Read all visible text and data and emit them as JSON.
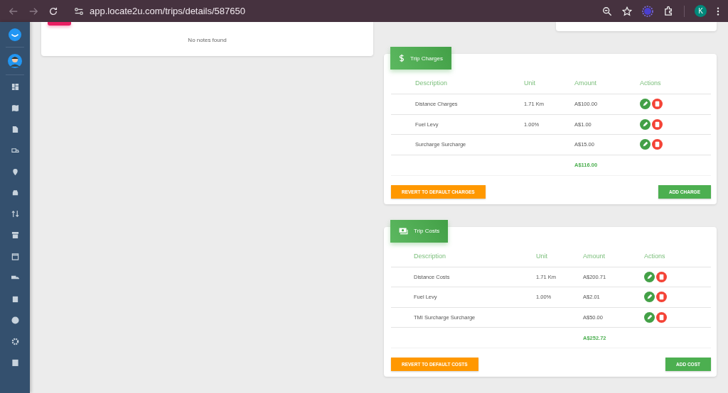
{
  "browser": {
    "url": "app.locate2u.com/trips/details/587650",
    "profile": "K"
  },
  "notes": {
    "empty_text": "No notes found"
  },
  "sections": [
    {
      "title": "Trip Charges",
      "kind": "charges",
      "columns": [
        "Description",
        "Unit",
        "Amount",
        "Actions"
      ],
      "rows": [
        {
          "description": "Distance Charges",
          "unit": "1.71 Km",
          "amount": "A$100.00"
        },
        {
          "description": "Fuel Levy",
          "unit": "1.00%",
          "amount": "A$1.00"
        },
        {
          "description": "Surcharge Surcharge",
          "unit": "",
          "amount": "A$15.00"
        }
      ],
      "total": "A$116.00",
      "revert_button": "REVERT TO DEFAULT CHARGES",
      "add_button": "ADD CHARGE"
    },
    {
      "title": "Trip Costs",
      "kind": "costs",
      "columns": [
        "Description",
        "Unit",
        "Amount",
        "Actions"
      ],
      "rows": [
        {
          "description": "Distance Costs",
          "unit": "1.71 Km",
          "amount": "A$200.71"
        },
        {
          "description": "Fuel Levy",
          "unit": "1.00%",
          "amount": "A$2.01"
        },
        {
          "description": "TMI Surcharge Surcharge",
          "unit": "",
          "amount": "A$50.00"
        }
      ],
      "total": "A$252.72",
      "revert_button": "REVERT TO DEFAULT COSTS",
      "add_button": "ADD COST"
    }
  ]
}
